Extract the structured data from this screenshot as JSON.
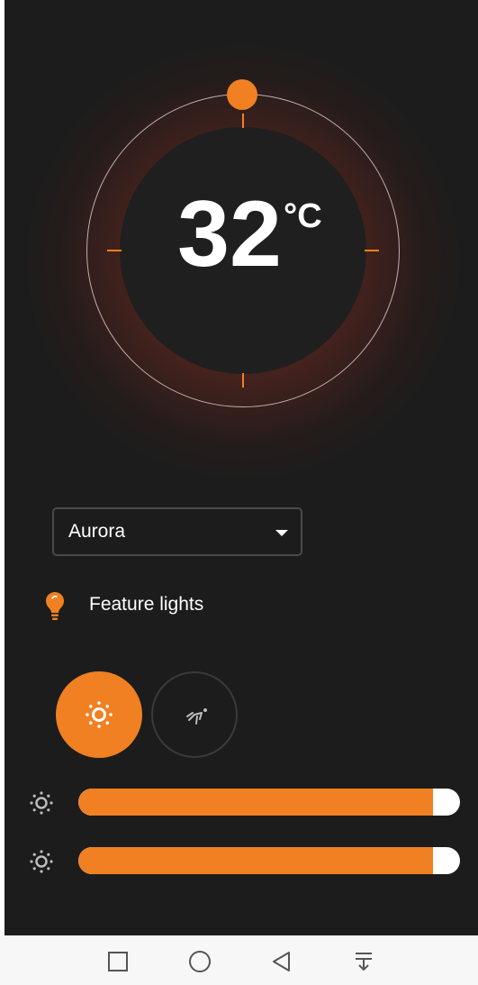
{
  "thermostat": {
    "temperature": "32",
    "unit": "°C"
  },
  "preset_select": {
    "value": "Aurora"
  },
  "feature": {
    "label": "Feature lights",
    "icon": "lightbulb-icon"
  },
  "modes": [
    {
      "icon": "sun-icon",
      "active": true
    },
    {
      "icon": "running-figure-icon",
      "active": false
    }
  ],
  "sliders": [
    {
      "icon": "brightness-icon",
      "level": 0.93
    },
    {
      "icon": "brightness-icon",
      "level": 0.93
    }
  ],
  "nav": [
    {
      "icon": "recent-apps-square-icon"
    },
    {
      "icon": "home-circle-icon"
    },
    {
      "icon": "back-triangle-icon"
    },
    {
      "icon": "notification-pulldown-icon"
    }
  ],
  "colors": {
    "accent": "#f08022",
    "background": "#1c1c1c",
    "text": "#ffffff"
  }
}
